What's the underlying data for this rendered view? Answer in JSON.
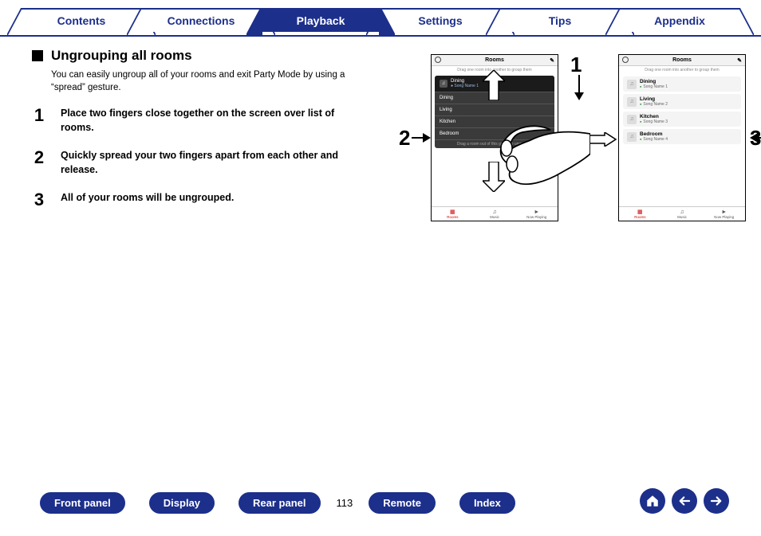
{
  "tabs": {
    "contents": "Contents",
    "connections": "Connections",
    "playback": "Playback",
    "settings": "Settings",
    "tips": "Tips",
    "appendix": "Appendix",
    "active": "playback"
  },
  "section": {
    "heading": "Ungrouping all rooms",
    "intro": "You can easily ungroup all of your rooms and exit Party Mode by using a “spread” gesture.",
    "steps": [
      "Place two fingers close together on the screen over list of rooms.",
      "Quickly spread your two fingers apart from each other and release.",
      "All of your rooms will be ungrouped."
    ]
  },
  "phones": {
    "title": "Rooms",
    "drag_hint": "Drag one room into another to group them",
    "drag_out": "Drag a room out of this group to ungroup it",
    "footer": {
      "rooms": "Rooms",
      "music": "Music",
      "now": "Now Playing"
    },
    "left": {
      "head_room": "Dining",
      "head_song": "Song Name 1",
      "rooms": [
        "Dining",
        "Living",
        "Kitchen",
        "Bedroom"
      ]
    },
    "right": {
      "rooms": [
        {
          "name": "Dining",
          "song": "Song Name 1"
        },
        {
          "name": "Living",
          "song": "Song Name 2"
        },
        {
          "name": "Kitchen",
          "song": "Song Name 3"
        },
        {
          "name": "Bedroom",
          "song": "Song Name 4"
        }
      ]
    },
    "labels": {
      "n1": "1",
      "n2": "2",
      "n3": "3"
    }
  },
  "bottom": {
    "front_panel": "Front panel",
    "display": "Display",
    "rear_panel": "Rear panel",
    "remote": "Remote",
    "index": "Index",
    "page": "113"
  }
}
